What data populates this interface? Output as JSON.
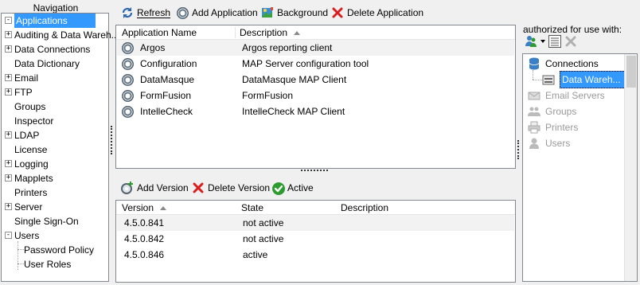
{
  "navigation": {
    "title": "Navigation",
    "items": [
      {
        "label": "Applications",
        "selected": true,
        "expander": "-"
      },
      {
        "label": "Auditing & Data Wareh...",
        "expander": "+"
      },
      {
        "label": "Data Connections",
        "expander": "+"
      },
      {
        "label": "Data Dictionary"
      },
      {
        "label": "Email",
        "expander": "+"
      },
      {
        "label": "FTP",
        "expander": "+"
      },
      {
        "label": "Groups"
      },
      {
        "label": "Inspector"
      },
      {
        "label": "LDAP",
        "expander": "+"
      },
      {
        "label": "License"
      },
      {
        "label": "Logging",
        "expander": "+"
      },
      {
        "label": "Mapplets",
        "expander": "+"
      },
      {
        "label": "Printers"
      },
      {
        "label": "Server",
        "expander": "+"
      },
      {
        "label": "Single Sign-On"
      },
      {
        "label": "Users",
        "expander": "-"
      },
      {
        "label": "Password Policy",
        "child": true
      },
      {
        "label": "User Roles",
        "child": true
      }
    ]
  },
  "main_toolbar": {
    "refresh_label": "Refresh",
    "add_application_label": "Add Application",
    "background_label": "Background",
    "delete_application_label": "Delete Application"
  },
  "applications_grid": {
    "columns": [
      "Application Name",
      "Description"
    ],
    "rows": [
      {
        "name": "Argos",
        "description": "Argos reporting client"
      },
      {
        "name": "Configuration",
        "description": "MAP Server configuration tool"
      },
      {
        "name": "DataMasque",
        "description": "DataMasque MAP Client"
      },
      {
        "name": "FormFusion",
        "description": "FormFusion"
      },
      {
        "name": "IntelleCheck",
        "description": "IntelleCheck MAP Client"
      }
    ]
  },
  "version_toolbar": {
    "add_version_label": "Add Version",
    "delete_version_label": "Delete Version",
    "active_label": "Active"
  },
  "versions_grid": {
    "columns": [
      "Version",
      "State",
      "Description"
    ],
    "rows": [
      {
        "version": "4.5.0.841",
        "state": "not active",
        "description": ""
      },
      {
        "version": "4.5.0.842",
        "state": "not active",
        "description": ""
      },
      {
        "version": "4.5.0.846",
        "state": "active",
        "description": ""
      }
    ]
  },
  "authorized": {
    "label": "authorized for use with:",
    "items": [
      {
        "label": "Connections",
        "disabled": false
      },
      {
        "label": "Data Wareh...",
        "disabled": false,
        "selected": true
      },
      {
        "label": "Email Servers",
        "disabled": true
      },
      {
        "label": "Groups",
        "disabled": true
      },
      {
        "label": "Printers",
        "disabled": true
      },
      {
        "label": "Users",
        "disabled": true
      }
    ]
  },
  "colors": {
    "selection": "#3399ff",
    "delete_red": "#d81e1e",
    "active_green": "#2e9b2e",
    "disabled_text": "#9a9a9a"
  }
}
